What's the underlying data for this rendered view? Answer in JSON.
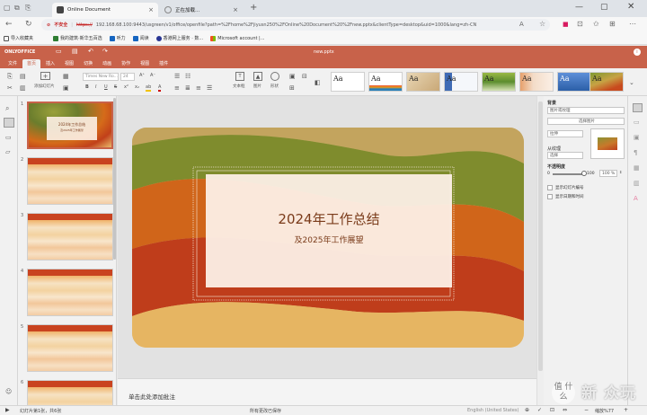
{
  "browser": {
    "tabs": [
      {
        "title": "Online Document",
        "active": true
      },
      {
        "title": "正在加载...",
        "active": false
      }
    ],
    "new_tab": "+",
    "url_warning": "不安全",
    "url_scheme": "https://",
    "url_rest": "192.168.68.100:9443/usgreen/v1/office/openfile?path=%2Fhome%2Fjiyusn250%2FOnline%20Document%20%2Fnew.pptx&clientType=desktop&uid=1000&lang=zh-CN",
    "bookmarks": [
      {
        "label": "导入收藏夹",
        "icon": "import-icon",
        "color": "#555555"
      },
      {
        "label": "我的建筑·新华五百选",
        "icon": "bookmark-icon",
        "color": "#2e7d32"
      },
      {
        "label": "听力",
        "icon": "bookmark-icon",
        "color": "#1565c0"
      },
      {
        "label": "阅读",
        "icon": "bookmark-icon",
        "color": "#1565c0"
      },
      {
        "label": "香港网上服务 · 数...",
        "icon": "globe-icon",
        "color": "#283593"
      },
      {
        "label": "Microsoft account |...",
        "icon": "microsoft-icon",
        "color": "#e65100"
      }
    ]
  },
  "app": {
    "brand": "ONLYOFFICE",
    "doc_title": "new.pptx",
    "accent": "#c8624a",
    "menu_tabs": [
      "文件",
      "首页",
      "插入",
      "视图",
      "切换",
      "动画",
      "协作",
      "视图",
      "插件"
    ],
    "active_tab": 1,
    "ribbon": {
      "add_slide": "添加幻灯片",
      "font_name": "Times New Ro...",
      "font_size": "24",
      "textbox": "文本框",
      "image": "图片",
      "shape": "形状",
      "theme_label": "Aa"
    }
  },
  "slides": [
    {
      "num": "1",
      "title": "2024年工作总结",
      "subtitle": "及2025年工作展望"
    },
    {
      "num": "2"
    },
    {
      "num": "3"
    },
    {
      "num": "4"
    },
    {
      "num": "5"
    },
    {
      "num": "6"
    }
  ],
  "main_slide": {
    "title": "2024年工作总结",
    "subtitle": "及2025年工作展望"
  },
  "notes_placeholder": "单击此处添加批注",
  "right_panel": {
    "section_title": "背景",
    "fill_type": "图片或纹理",
    "select_image": "选择图片",
    "from_file": "从文件",
    "stretch": "拉伸",
    "texture_label": "从纹理",
    "texture_select": "选择",
    "opacity_label": "不透明度",
    "opacity_min": "0",
    "opacity_max": "100",
    "opacity_value": "100 %",
    "show_slide_number": "显示幻灯片编号",
    "show_date": "显示日期和时间"
  },
  "status": {
    "slide_info": "幻灯片第1张，共6张",
    "saved": "所有更改已保存",
    "language": "English (United States)",
    "zoom": "缩放%77"
  },
  "watermark": {
    "text": "新 众玩",
    "badge": "值 什么"
  }
}
